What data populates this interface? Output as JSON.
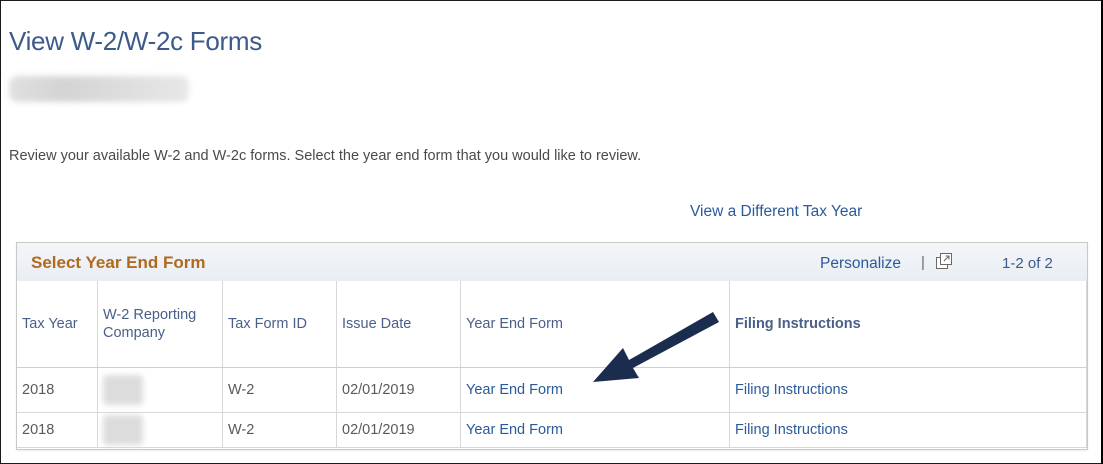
{
  "page": {
    "title": "View W-2/W-2c Forms",
    "description": "Review your available W-2 and W-2c forms. Select the year end form that you would like to review.",
    "different_year_link": "View a Different Tax Year"
  },
  "grid": {
    "title": "Select Year End Form",
    "personalize_label": "Personalize",
    "separator": "|",
    "count": "1-2 of 2",
    "columns": {
      "tax_year": "Tax Year",
      "reporting_company": "W-2 Reporting Company",
      "tax_form_id": "Tax Form ID",
      "issue_date": "Issue Date",
      "year_end_form": "Year End Form",
      "filing_instructions": "Filing Instructions"
    },
    "rows": [
      {
        "tax_year": "2018",
        "tax_form_id": "W-2",
        "issue_date": "02/01/2019",
        "year_end_form": "Year End Form",
        "filing_instructions": "Filing Instructions"
      },
      {
        "tax_year": "2018",
        "tax_form_id": "W-2",
        "issue_date": "02/01/2019",
        "year_end_form": "Year End Form",
        "filing_instructions": "Filing Instructions"
      }
    ]
  },
  "colors": {
    "title": "#3c5a8a",
    "grid_title": "#b06a1f",
    "link": "#2a5a9a",
    "arrow": "#1a2d4f"
  },
  "icons": {
    "popout": "popout-window-icon",
    "annotation": "annotation-arrow-icon"
  }
}
